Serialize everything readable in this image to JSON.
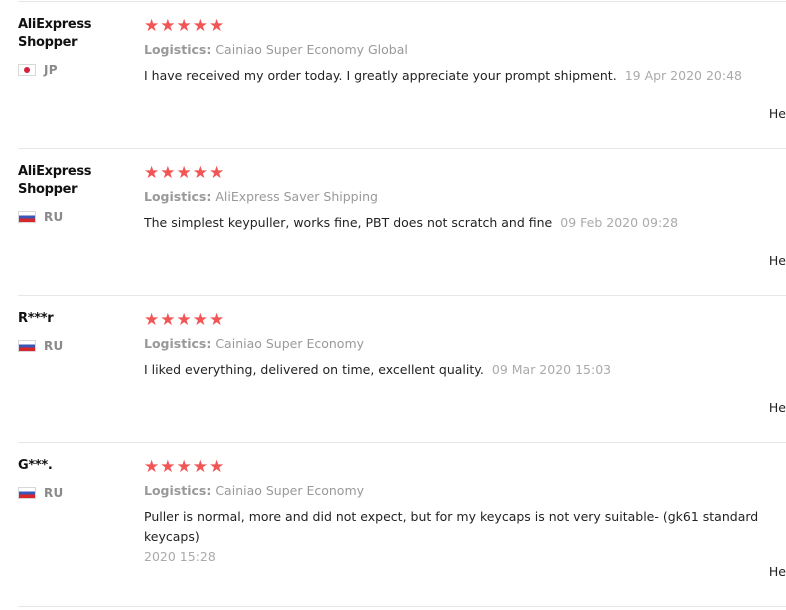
{
  "reviews": [
    {
      "user_name": "AliExpress Shopper",
      "country": "JP",
      "stars": "★★★★★",
      "logistics_label": "Logistics:",
      "logistics_value": "Cainiao Super Economy Global",
      "feedback": "I have received my order today. I greatly appreciate your prompt shipment.",
      "date": "19 Apr 2020 20:48",
      "helpful_label": "He"
    },
    {
      "user_name": "AliExpress Shopper",
      "country": "RU",
      "stars": "★★★★★",
      "logistics_label": "Logistics:",
      "logistics_value": "AliExpress Saver Shipping",
      "feedback": "The simplest keypuller, works fine, PBT does not scratch and fine",
      "date": "09 Feb 2020 09:28",
      "helpful_label": "He"
    },
    {
      "user_name": "R***r",
      "country": "RU",
      "stars": "★★★★★",
      "logistics_label": "Logistics:",
      "logistics_value": "Cainiao Super Economy",
      "feedback": "I liked everything, delivered on time, excellent quality.",
      "date": "09 Mar 2020 15:03",
      "helpful_label": "He"
    },
    {
      "user_name": "G***.",
      "country": "RU",
      "stars": "★★★★★",
      "logistics_label": "Logistics:",
      "logistics_value": "Cainiao Super Economy",
      "feedback": "Puller is normal, more and did not expect, but for my keycaps is not very suitable- (gk61 standard keycaps)",
      "date": "2020 15:28",
      "helpful_label": "He"
    }
  ],
  "colors": {
    "star": "#f25555",
    "muted_text": "#999999",
    "divider": "#e6e6e6"
  }
}
